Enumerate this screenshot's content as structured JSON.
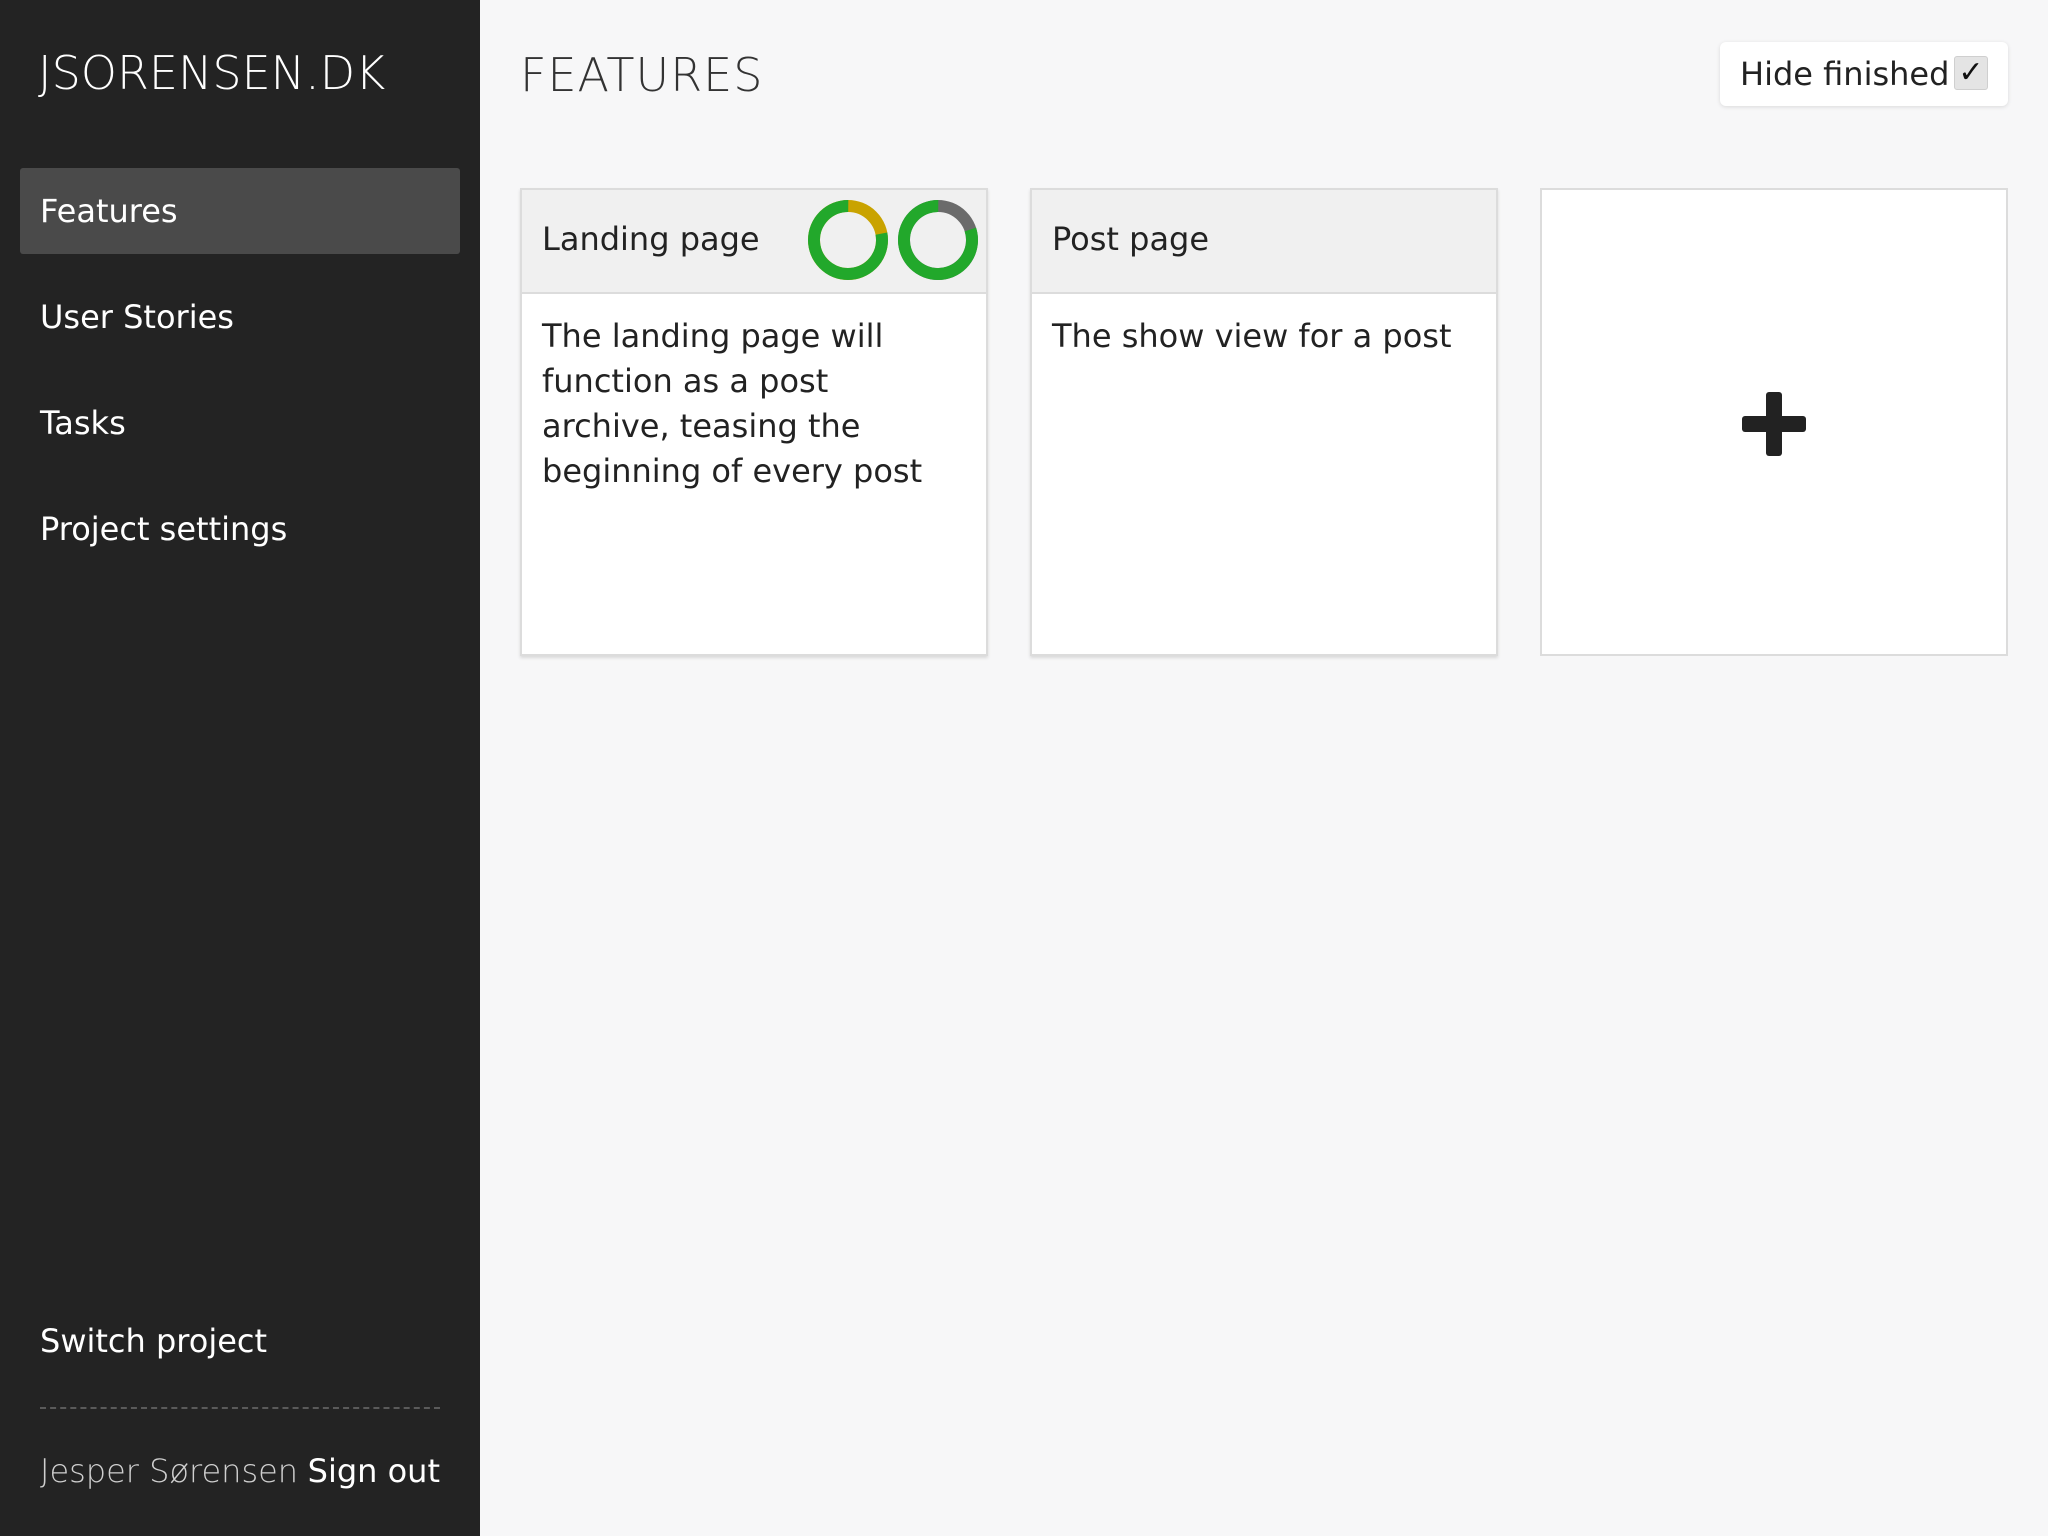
{
  "sidebar": {
    "logo": "JSORENSEN.DK",
    "items": [
      {
        "label": "Features",
        "active": true
      },
      {
        "label": "User Stories",
        "active": false
      },
      {
        "label": "Tasks",
        "active": false
      },
      {
        "label": "Project settings",
        "active": false
      }
    ],
    "switch_project": "Switch project",
    "user_name": "Jesper Sørensen",
    "sign_out": "Sign out"
  },
  "main": {
    "title": "FEATURES",
    "hide_finished": {
      "label": "Hide finished",
      "checked": true,
      "check_mark": "✓"
    },
    "cards": [
      {
        "title": "Landing page",
        "description": "The landing page will function as a post archive, teasing the beginning of every post",
        "progress": [
          {
            "done_fraction": 0.78,
            "done_color": "#22a82b",
            "rest_color": "#c9a300"
          },
          {
            "done_fraction": 0.8,
            "done_color": "#22a82b",
            "rest_color": "#6b6b6b"
          }
        ]
      },
      {
        "title": "Post page",
        "description": "The show view for a post",
        "progress": []
      }
    ],
    "add_card_icon": "plus-icon"
  },
  "colors": {
    "sidebar_bg": "#232323",
    "active_item_bg": "#4a4a4a",
    "main_bg": "#f7f7f8",
    "card_header_bg": "#f0f0f0",
    "progress_done": "#22a82b",
    "progress_warning": "#c9a300",
    "progress_neutral": "#6b6b6b"
  }
}
